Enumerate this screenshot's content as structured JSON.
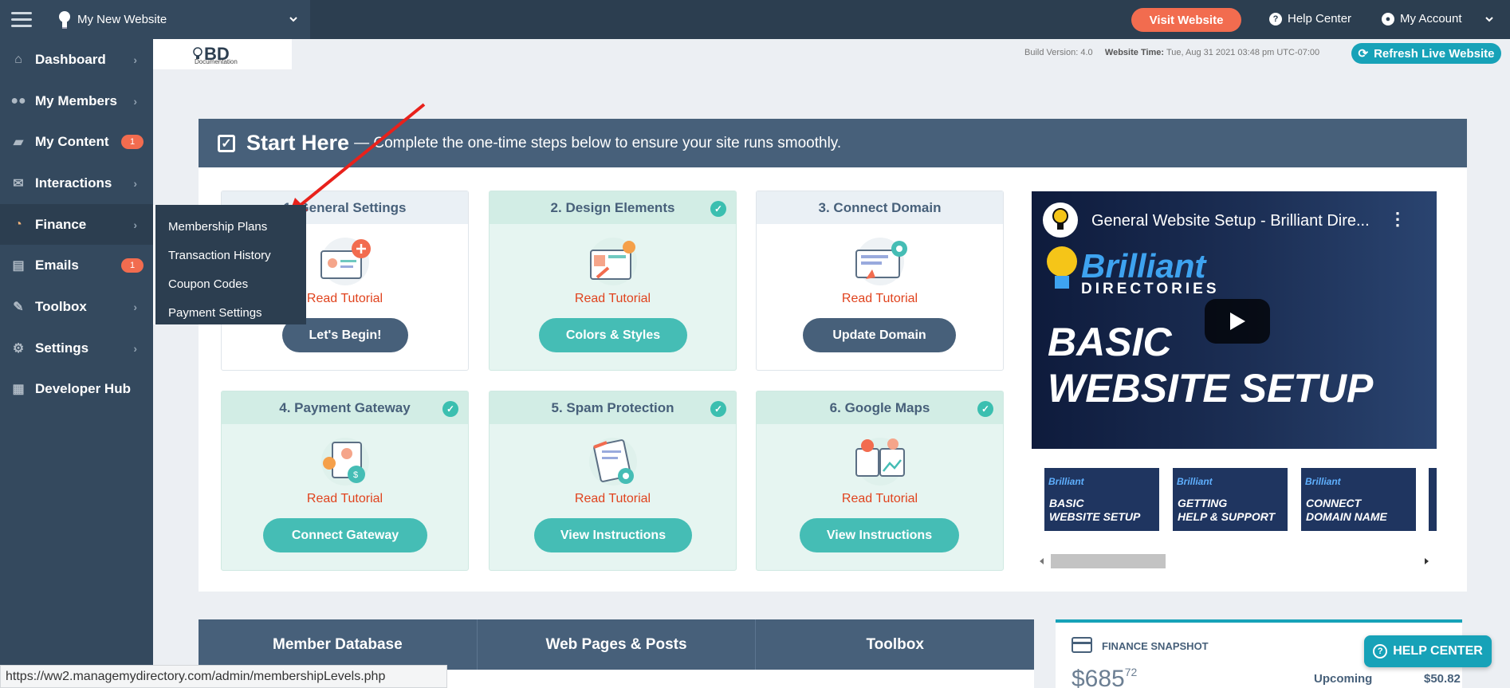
{
  "topbar": {
    "site_name": "My New Website",
    "visit_label": "Visit Website",
    "help_label": "Help Center",
    "account_label": "My Account"
  },
  "sidebar": {
    "items": [
      {
        "label": "Dashboard",
        "icon": "home-icon"
      },
      {
        "label": "My Members",
        "icon": "users-icon"
      },
      {
        "label": "My Content",
        "icon": "folder-icon",
        "badge": "1"
      },
      {
        "label": "Interactions",
        "icon": "comments-icon"
      },
      {
        "label": "Finance",
        "icon": "pie-chart-icon"
      },
      {
        "label": "Emails",
        "icon": "inbox-icon",
        "badge": "1"
      },
      {
        "label": "Toolbox",
        "icon": "wrench-icon"
      },
      {
        "label": "Settings",
        "icon": "gear-icon"
      },
      {
        "label": "Developer Hub",
        "icon": "grid-icon"
      }
    ],
    "finance_submenu": [
      "Membership Plans",
      "Transaction History",
      "Coupon Codes",
      "Payment Settings"
    ]
  },
  "header": {
    "logo_text": "BD",
    "logo_sub": "Documentation",
    "build_label": "Build Version:",
    "build_value": "4.0",
    "time_label": "Website Time:",
    "time_value": "Tue, Aug 31 2021 03:48 pm UTC-07:00",
    "refresh_label": "Refresh Live Website"
  },
  "start_here": {
    "title": "Start Here",
    "subtitle": "— Complete the one-time steps below to ensure your site runs smoothly.",
    "cards": [
      {
        "title": "1. General Settings",
        "tutorial": "Read Tutorial",
        "button": "Let's Begin!",
        "done": false
      },
      {
        "title": "2. Design Elements",
        "tutorial": "Read Tutorial",
        "button": "Colors & Styles",
        "done": true
      },
      {
        "title": "3. Connect Domain",
        "tutorial": "Read Tutorial",
        "button": "Update Domain",
        "done": false
      },
      {
        "title": "4. Payment Gateway",
        "tutorial": "Read Tutorial",
        "button": "Connect Gateway",
        "done": true
      },
      {
        "title": "5. Spam Protection",
        "tutorial": "Read Tutorial",
        "button": "View Instructions",
        "done": true
      },
      {
        "title": "6. Google Maps",
        "tutorial": "Read Tutorial",
        "button": "View Instructions",
        "done": true
      }
    ]
  },
  "video": {
    "title": "General Website Setup - Brilliant Dire...",
    "brand_line1": "Brilliant",
    "brand_line2": "DIRECTORIES",
    "headline1": "BASIC",
    "headline2": "WEBSITE SETUP",
    "thumbs": [
      {
        "brand": "Brilliant",
        "line1": "BASIC",
        "line2": "WEBSITE SETUP"
      },
      {
        "brand": "Brilliant",
        "line1": "GETTING",
        "line2": "HELP & SUPPORT"
      },
      {
        "brand": "Brilliant",
        "line1": "CONNECT",
        "line2": "DOMAIN NAME"
      }
    ]
  },
  "bottom": {
    "tabs": [
      "Member Database",
      "Web Pages & Posts",
      "Toolbox"
    ],
    "finance_label": "FINANCE SNAPSHOT",
    "finance_amount": "$685",
    "finance_cents": "72",
    "upcoming_label": "Upcoming",
    "upcoming_value": "$50.82",
    "help_button": "HELP CENTER"
  },
  "status_url": "https://ww2.managemydirectory.com/admin/membershipLevels.php",
  "colors": {
    "sidebar": "#34495e",
    "topbar": "#2c3e50",
    "accent_orange": "#f26c4f",
    "accent_teal": "#45bdb5",
    "accent_blue": "#17a2b8",
    "panel_header": "#47607a"
  }
}
